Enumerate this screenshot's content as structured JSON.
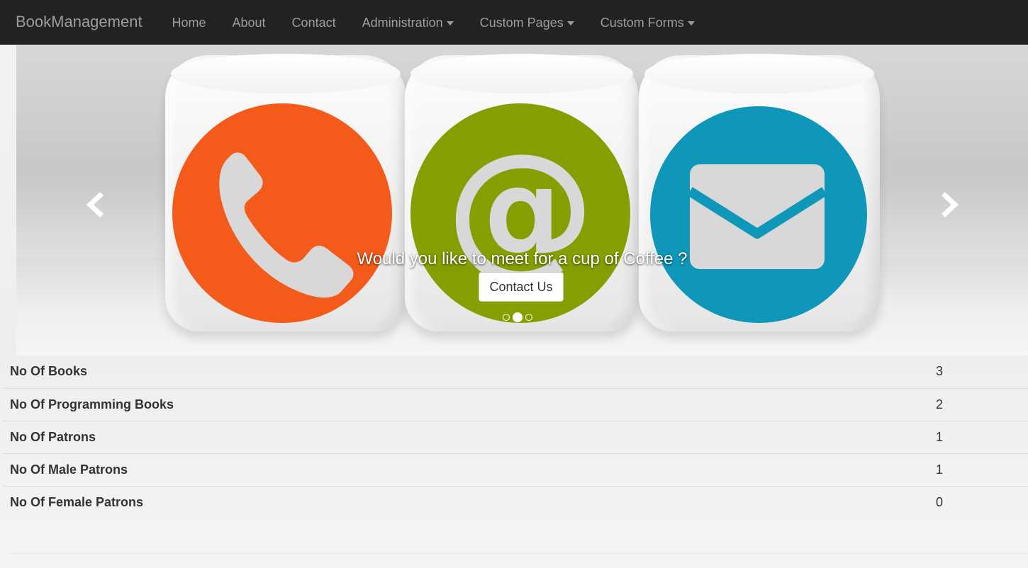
{
  "navbar": {
    "brand": "BookManagement",
    "items": [
      {
        "label": "Home",
        "dropdown": false
      },
      {
        "label": "About",
        "dropdown": false
      },
      {
        "label": "Contact",
        "dropdown": false
      },
      {
        "label": "Administration",
        "dropdown": true
      },
      {
        "label": "Custom Pages",
        "dropdown": true
      },
      {
        "label": "Custom Forms",
        "dropdown": true
      }
    ]
  },
  "carousel": {
    "caption": "Would you like to meet for a cup of Coffee ?",
    "button_label": "Contact Us",
    "slide_count": 3,
    "active_slide": 2,
    "icons": [
      "phone-icon",
      "at-sign-icon",
      "envelope-icon"
    ],
    "icon_colors": [
      "#f45a19",
      "#84a000",
      "#0e97b8"
    ]
  },
  "stats": {
    "rows": [
      {
        "label": "No Of Books",
        "value": "3"
      },
      {
        "label": "No Of Programming Books",
        "value": "2"
      },
      {
        "label": "No Of Patrons",
        "value": "1"
      },
      {
        "label": "No Of Male Patrons",
        "value": "1"
      },
      {
        "label": "No Of Female Patrons",
        "value": "0"
      }
    ]
  }
}
